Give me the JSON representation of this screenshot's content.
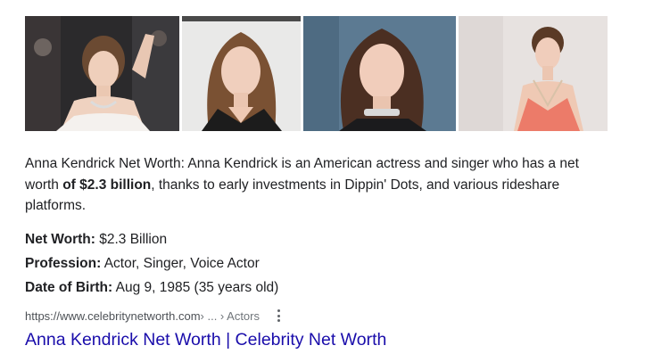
{
  "images": [
    {
      "alt": "red carpet waving photo"
    },
    {
      "alt": "studio portrait photo"
    },
    {
      "alt": "portrait with choker necklace"
    },
    {
      "alt": "red carpet coral dress photo"
    }
  ],
  "snippet": {
    "before": "Anna Kendrick Net Worth: Anna Kendrick is an American actress and singer who has a net worth ",
    "bold": "of $2.3 billion",
    "after": ", thanks to early investments in Dippin' Dots, and various rideshare platforms."
  },
  "facts": [
    {
      "label": "Net Worth:",
      "value": " $2.3 Billion"
    },
    {
      "label": "Profession:",
      "value": " Actor, Singer, Voice Actor"
    },
    {
      "label": "Date of Birth:",
      "value": " Aug 9, 1985 (35 years old)"
    }
  ],
  "result": {
    "url": "https://www.celebritynetworth.com",
    "breadcrumb": " › ... › Actors",
    "title": "Anna Kendrick Net Worth | Celebrity Net Worth"
  },
  "colors": {
    "link": "#1a0dab",
    "text": "#202124",
    "cite": "#4d5156"
  }
}
